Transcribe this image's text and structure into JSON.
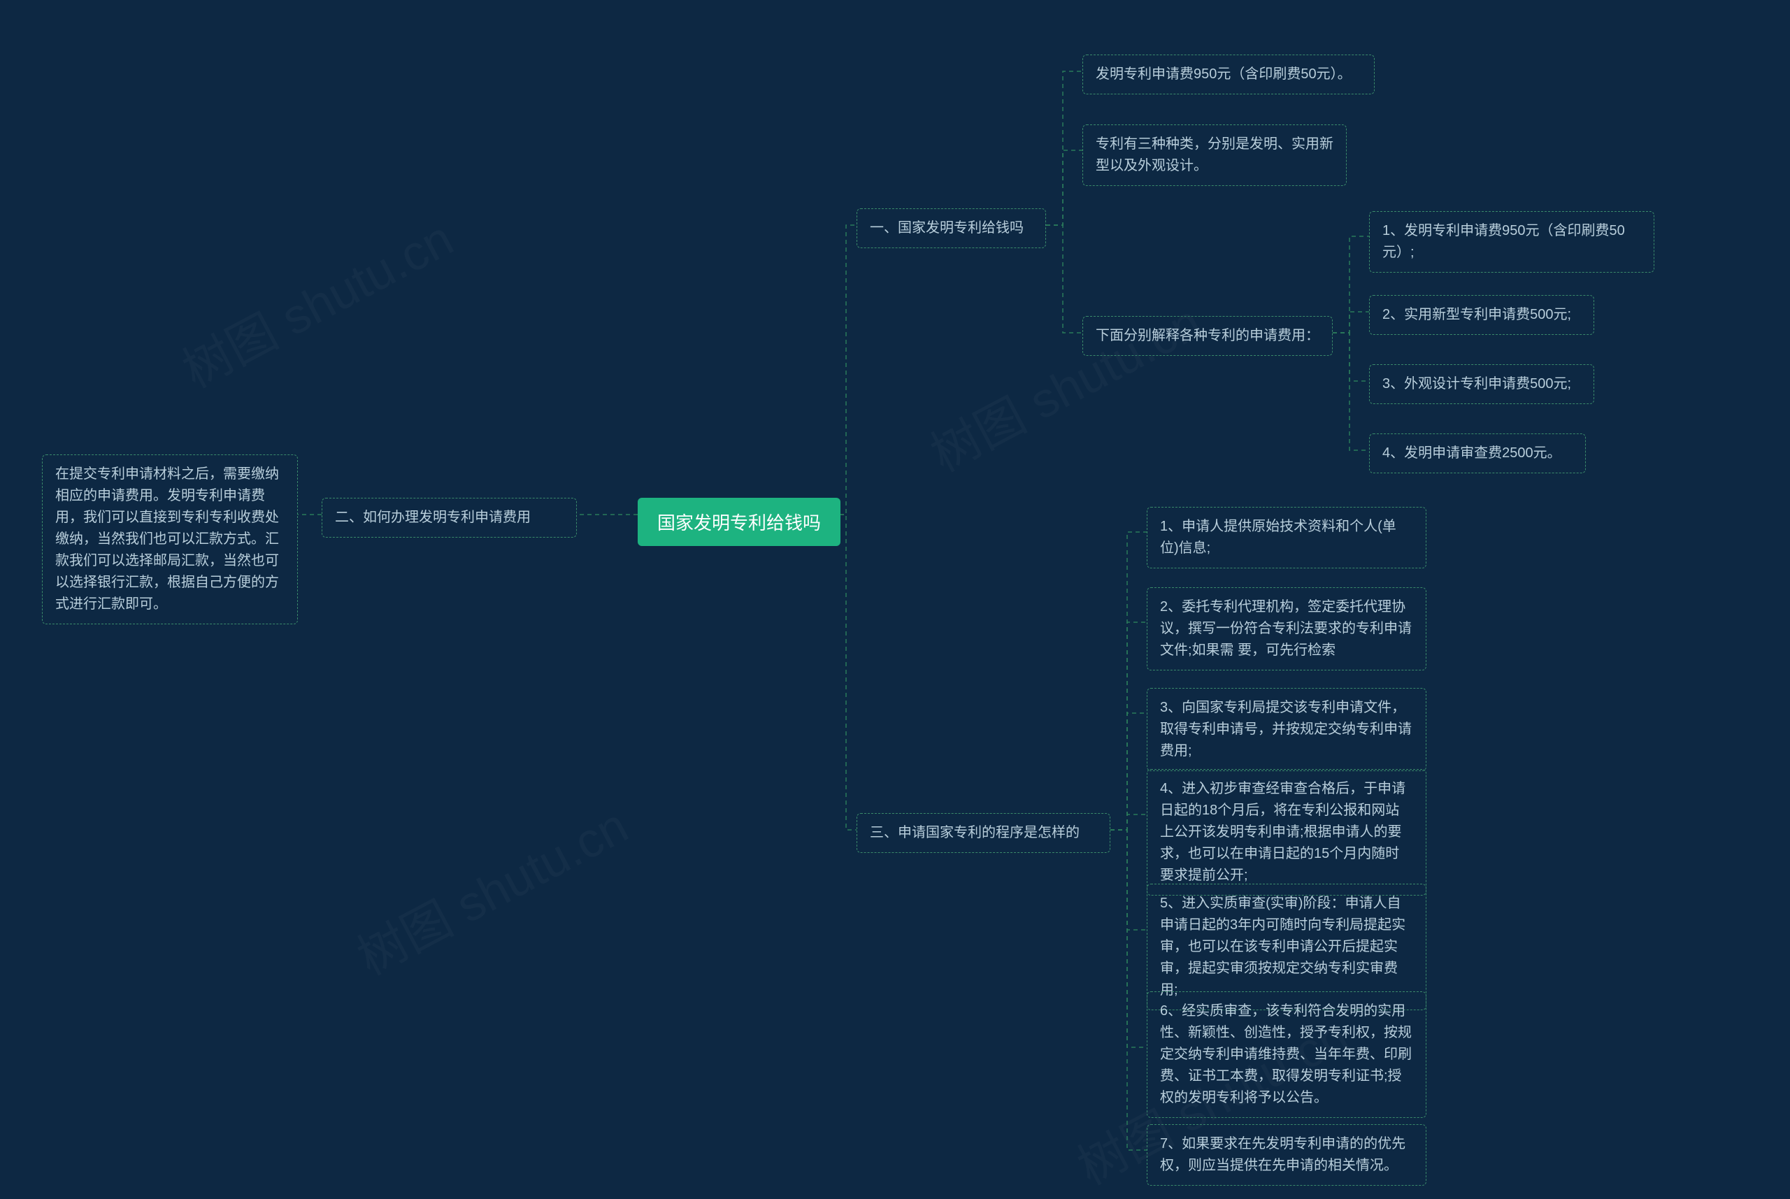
{
  "watermark": "树图 shutu.cn",
  "root": {
    "label": "国家发明专利给钱吗"
  },
  "branch_left": {
    "title": "二、如何办理发明专利申请费用",
    "detail": "在提交专利申请材料之后，需要缴纳相应的申请费用。发明专利申请费用，我们可以直接到专利专利收费处缴纳，当然我们也可以汇款方式。汇款我们可以选择邮局汇款，当然也可以选择银行汇款，根据自己方便的方式进行汇款即可。"
  },
  "branch1": {
    "title": "一、国家发明专利给钱吗",
    "items": [
      "发明专利申请费950元（含印刷费50元）。",
      "专利有三种种类，分别是发明、实用新型以及外观设计。"
    ],
    "sub": {
      "title": "下面分别解释各种专利的申请费用：",
      "items": [
        "1、发明专利申请费950元（含印刷费50元）;",
        "2、实用新型专利申请费500元;",
        "3、外观设计专利申请费500元;",
        "4、发明申请审查费2500元。"
      ]
    }
  },
  "branch3": {
    "title": "三、申请国家专利的程序是怎样的",
    "items": [
      "1、申请人提供原始技术资料和个人(单位)信息;",
      "2、委托专利代理机构，签定委托代理协议，撰写一份符合专利法要求的专利申请文件;如果需 要，可先行检索",
      "3、向国家专利局提交该专利申请文件，取得专利申请号，并按规定交纳专利申请费用;",
      "4、进入初步审查经审查合格后，于申请日起的18个月后，将在专利公报和网站上公开该发明专利申请;根据申请人的要求，也可以在申请日起的15个月内随时要求提前公开;",
      "5、进入实质审查(实审)阶段：申请人自申请日起的3年内可随时向专利局提起实审，也可以在该专利申请公开后提起实审，提起实审须按规定交纳专利实审费用;",
      "6、经实质审查，该专利符合发明的实用性、新颖性、创造性，授予专利权，按规定交纳专利申请维持费、当年年费、印刷费、证书工本费，取得发明专利证书;授权的发明专利将予以公告。",
      "7、如果要求在先发明专利申请的的优先权，则应当提供在先申请的相关情况。"
    ]
  }
}
